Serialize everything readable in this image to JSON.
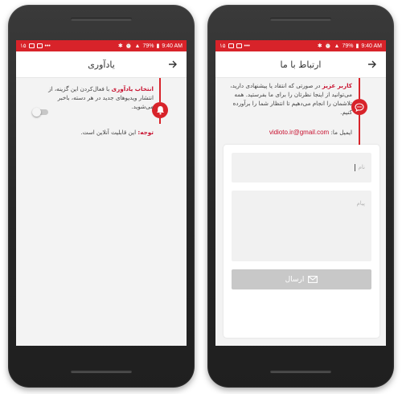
{
  "status_bar": {
    "notif_count": "۱۵",
    "battery": "79%",
    "time": "9:40 AM"
  },
  "colors": {
    "status_bar": "#d8232a",
    "accent": "#d8232a",
    "screen_bg": "#f3f3f3"
  },
  "reminder_screen": {
    "title": "یادآوری",
    "back_icon": "arrow-right-icon",
    "badge_icon": "bell-icon",
    "option_title": "انتخاب یادآوری",
    "option_text": "با فعال‌کردن این گزینه، از انتشار ویدیوهای جدید در هر دسته، باخبر می‌شوید.",
    "toggle_on": false,
    "note_label": "توجه:",
    "note_text": "این قابلیت آنلاین است."
  },
  "contact_screen": {
    "title": "ارتباط با ما",
    "back_icon": "arrow-right-icon",
    "badge_icon": "chat-icon",
    "intro_bold": "کاربر عزیز",
    "intro_text": "در صورتی که انتقاد یا پیشنهادی دارید، می‌توانید از اینجا نظرتان را برای ما بفرستید. همه تلاشمان را انجام می‌دهیم تا انتظار شما را برآورده کنیم.",
    "email_label": "ایمیل ما:",
    "email_value": "vidioto.ir@gmail.com",
    "name_placeholder": "نام",
    "message_placeholder": "پیام",
    "send_label": "ارسال",
    "send_icon": "envelope-icon"
  }
}
